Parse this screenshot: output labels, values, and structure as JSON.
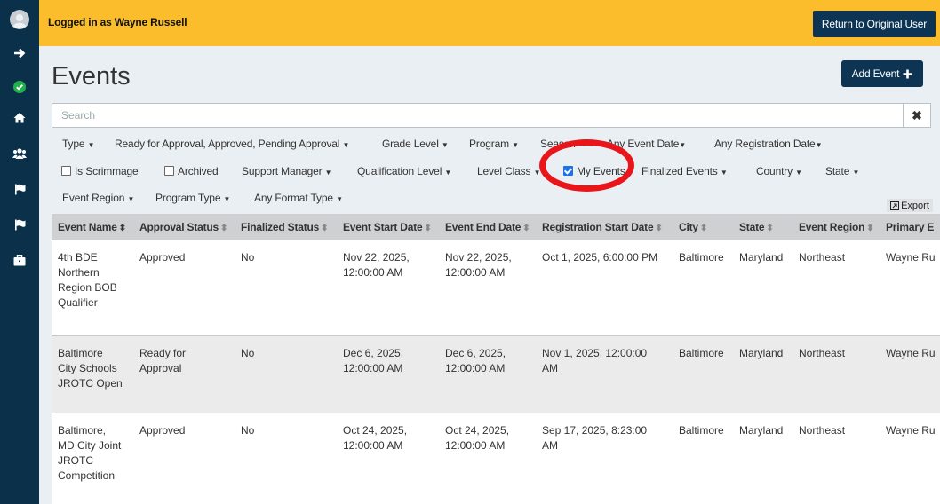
{
  "sidebar": {
    "icons": [
      "avatar-icon",
      "arrow-right-icon",
      "check-circle-icon",
      "home-icon",
      "users-icon",
      "flag-icon",
      "flag-icon",
      "briefcase-icon"
    ]
  },
  "banner": {
    "logged_in_text": "Logged in as Wayne Russell",
    "return_button": "Return to Original User"
  },
  "page": {
    "title": "Events",
    "add_button": "Add Event"
  },
  "search": {
    "placeholder": "Search",
    "clear_label": "✖"
  },
  "filters": {
    "type": "Type",
    "approval": "Ready for Approval, Approved, Pending Approval",
    "grade_level": "Grade Level",
    "program": "Program",
    "season": "Season",
    "event_date": "Any Event Date",
    "registration_date": "Any Registration Date",
    "is_scrimmage": "Is Scrimmage",
    "archived": "Archived",
    "support_manager": "Support Manager",
    "qualification_level": "Qualification Level",
    "level_class": "Level Class",
    "my_events": "My Events",
    "my_events_checked": true,
    "finalized_events": "Finalized Events",
    "country": "Country",
    "state": "State",
    "event_region": "Event Region",
    "program_type": "Program Type",
    "format_type": "Any Format Type"
  },
  "export_label": "Export",
  "table": {
    "columns": [
      "Event Name",
      "Approval Status",
      "Finalized Status",
      "Event Start Date",
      "Event End Date",
      "Registration Start Date",
      "City",
      "State",
      "Event Region",
      "Primary E"
    ],
    "rows": [
      [
        "4th BDE\nNorthern\nRegion BOB\nQualifier",
        "Approved",
        "No",
        "Nov 22, 2025,\n12:00:00 AM",
        "Nov 22, 2025,\n12:00:00 AM",
        "Oct 1, 2025, 6:00:00 PM",
        "Baltimore",
        "Maryland",
        "Northeast",
        "Wayne Ru"
      ],
      [
        "Baltimore\nCity Schools\nJROTC Open",
        "Ready for\nApproval",
        "No",
        "Dec 6, 2025,\n12:00:00 AM",
        "Dec 6, 2025,\n12:00:00 AM",
        "Nov 1, 2025, 12:00:00\nAM",
        "Baltimore",
        "Maryland",
        "Northeast",
        "Wayne Ru"
      ],
      [
        "Baltimore,\nMD City Joint\nJROTC\nCompetition",
        "Approved",
        "No",
        "Oct 24, 2025,\n12:00:00 AM",
        "Oct 24, 2025,\n12:00:00 AM",
        "Sep 17, 2025, 8:23:00\nAM",
        "Baltimore",
        "Maryland",
        "Northeast",
        "Wayne Ru"
      ]
    ]
  },
  "colors": {
    "sidebar": "#0b3049",
    "banner": "#fbbd2b",
    "primary_button": "#0d3553",
    "annotation_circle": "#e8161a",
    "checkbox_checked": "#1a73e8"
  }
}
